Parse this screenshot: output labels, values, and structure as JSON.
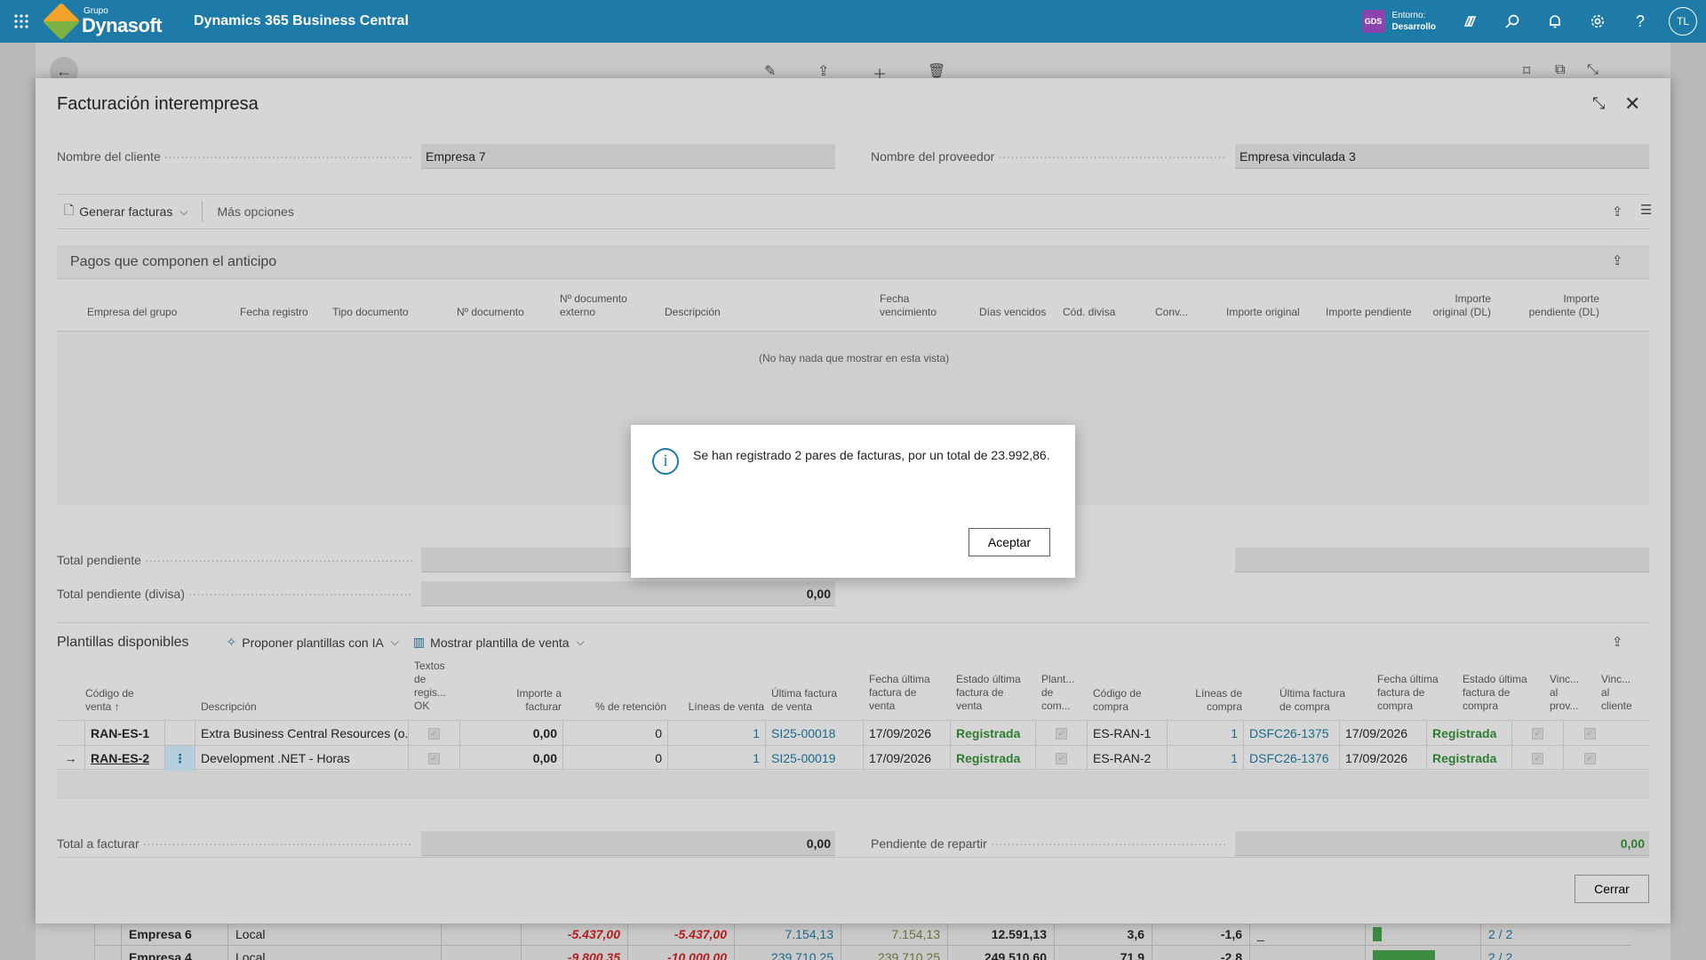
{
  "topbar": {
    "brand_small": "Grupo",
    "brand_name": "Dynasoft",
    "product": "Dynamics 365 Business Central",
    "env_badge": "GDS",
    "env_label": "Entorno:",
    "env_value": "Desarrollo",
    "avatar": "TL",
    "icons": [
      "copilot-icon",
      "search-icon",
      "bell-icon",
      "gear-icon",
      "help-icon"
    ]
  },
  "background_rows": [
    {
      "company": "Empresa 6",
      "type": "Local",
      "v1": "-5.437,00",
      "v2": "-5.437,00",
      "v3": "7.154,13",
      "v4": "7.154,13",
      "v5": "12.591,13",
      "v6": "3,6",
      "v7": "-1,6",
      "v8": "_",
      "v9": "2 / 2"
    },
    {
      "company": "Empresa 4",
      "type": "Local",
      "v1": "-9.800,35",
      "v2": "-10.000,00",
      "v3": "239.710,25",
      "v4": "239.710,25",
      "v5": "249.510,60",
      "v6": "71,9",
      "v7": "-2,8",
      "v8": "",
      "v9": "2 / 2"
    }
  ],
  "modal": {
    "title": "Facturación interempresa",
    "customer_label": "Nombre del cliente",
    "customer_value": "Empresa 7",
    "vendor_label": "Nombre del proveedor",
    "vendor_value": "Empresa vinculada 3",
    "actions": {
      "generate": "Generar facturas",
      "more": "Más opciones"
    },
    "payments": {
      "title": "Pagos que componen el anticipo",
      "columns": [
        "Empresa del grupo",
        "Fecha registro",
        "Tipo documento",
        "Nº documento",
        "Nº documento externo",
        "Descripción",
        "Fecha vencimiento",
        "Días vencidos",
        "Cód. divisa",
        "Conv...",
        "Importe original",
        "Importe pendiente",
        "Importe original (DL)",
        "Importe pendiente (DL)"
      ],
      "empty": "(No hay nada que mostrar en esta vista)"
    },
    "total_pending_label": "Total pendiente",
    "total_pending_fx_label": "Total pendiente (divisa)",
    "total_pending_fx_value": "0,00",
    "templates": {
      "title": "Plantillas disponibles",
      "ai_action": "Proponer plantillas con IA",
      "show_action": "Mostrar plantilla de venta",
      "columns": [
        "Código de venta ↑",
        "Descripción",
        "Textos de regis... OK",
        "Importe a facturar",
        "% de retención",
        "Líneas de venta",
        "Última factura de venta",
        "Fecha última factura de venta",
        "Estado última factura de venta",
        "Plant... de com...",
        "Código de compra",
        "Líneas de compra",
        "Última factura de compra",
        "Fecha última factura de compra",
        "Estado última factura de compra",
        "Vinc... al prov...",
        "Vinc... al cliente"
      ],
      "rows": [
        {
          "code": "RAN-ES-1",
          "desc": "Extra Business Central Resources (o...",
          "amount": "0,00",
          "ret": "0",
          "lines": "1",
          "inv": "SI25-00018",
          "date": "17/09/2026",
          "status": "Registrada",
          "pcode": "ES-RAN-1",
          "plines": "1",
          "pinv": "DSFC26-1375",
          "pdate": "17/09/2026",
          "pstatus": "Registrada"
        },
        {
          "code": "RAN-ES-2",
          "desc": "Development .NET - Horas",
          "amount": "0,00",
          "ret": "0",
          "lines": "1",
          "inv": "SI25-00019",
          "date": "17/09/2026",
          "status": "Registrada",
          "pcode": "ES-RAN-2",
          "plines": "1",
          "pinv": "DSFC26-1376",
          "pdate": "17/09/2026",
          "pstatus": "Registrada"
        }
      ]
    },
    "total_invoice_label": "Total a facturar",
    "total_invoice_value": "0,00",
    "pending_split_label": "Pendiente de repartir",
    "pending_split_value": "0,00",
    "close_button": "Cerrar"
  },
  "dialog": {
    "message": "Se han registrado 2 pares de facturas, por un total de 23.992,86.",
    "ok_button": "Aceptar"
  }
}
